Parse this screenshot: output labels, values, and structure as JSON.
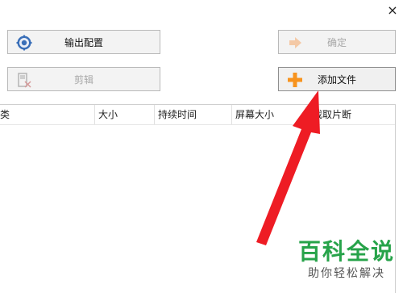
{
  "window": {
    "close_glyph": "×"
  },
  "buttons": {
    "output_label": "输出配置",
    "cut_label": "剪辑",
    "ok_label": "确定",
    "add_label": "添加文件"
  },
  "table": {
    "columns": [
      "类",
      "大小",
      "持续时间",
      "屏幕大小",
      "截取片断"
    ]
  },
  "watermark": {
    "main": "百科全说",
    "sub": "助你轻松解决"
  },
  "colors": {
    "arrow": "#ee1c24",
    "plus": "#f7931e",
    "watermark_green": "#27a34a"
  },
  "icons": [
    "settings-gear-icon",
    "cut-icon",
    "ok-arrow-icon",
    "plus-icon",
    "close-icon"
  ]
}
